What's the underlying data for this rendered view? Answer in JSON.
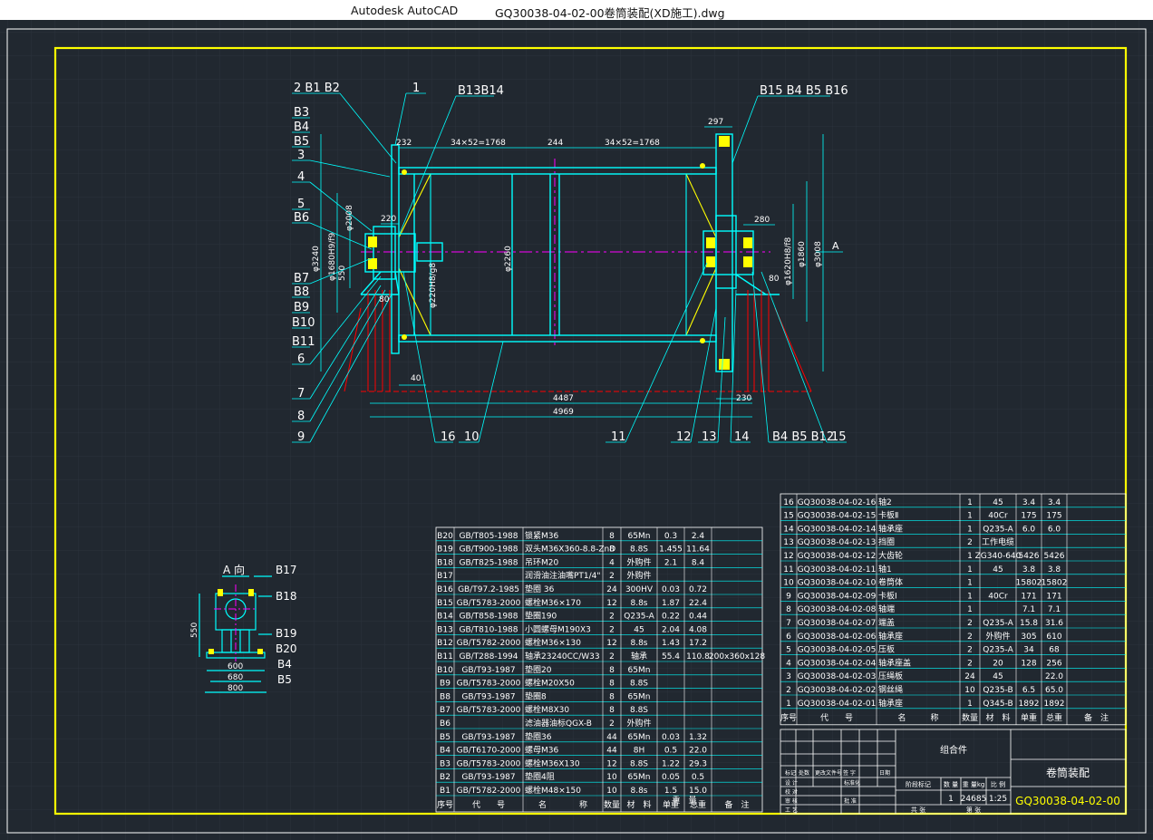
{
  "titlebar": {
    "app": "Autodesk AutoCAD",
    "file": "GQ30038-04-02-00卷筒装配(XD施工).dwg"
  },
  "colors": {
    "canvas": "#212830",
    "frame": "#ffff00",
    "outline": "#00ffff",
    "grid": "#2c3540",
    "centerline": "#ff00ff",
    "hidden": "#ff0000",
    "text": "#ffffff"
  },
  "drawing": {
    "balloons": {
      "b2b1b2": "2 B1 B2",
      "b1": "1",
      "b13b14": "B13B14",
      "b15b16": "B15 B4 B5 B16",
      "b3": "B3",
      "b4": "B4",
      "b5": "B5",
      "b3n": "3",
      "b4n": "4",
      "b5n": "5",
      "b6": "B6",
      "b7": "B7",
      "b8": "B8",
      "b9": "B9",
      "b10": "B10",
      "b11": "B11",
      "b6n": "6",
      "b7n": "7",
      "b8n": "8",
      "b9n": "9",
      "b16n": "16",
      "b10n": "10",
      "b11n": "11",
      "b12n": "12",
      "b13n": "13",
      "b14n": "14",
      "b4b5b12": "B4 B5 B12",
      "b15n": "15"
    },
    "dims": {
      "d297": "297",
      "d232": "232",
      "pitch_left": "34×52=1768",
      "d244": "244",
      "pitch_right": "34×52=1768",
      "d220": "220",
      "d280": "280",
      "d80": "80",
      "d40": "40",
      "d4487": "4487",
      "d4969": "4969",
      "d230": "230",
      "phi3240": "φ3240",
      "phi1680": "φ1680H9/f9",
      "phi2008": "φ2008",
      "d550": "550",
      "phi2260": "φ2260",
      "phi220": "φ220H8/g8",
      "phi1620": "φ1620H8/f8",
      "phi1860": "φ1860",
      "phi3008": "φ3008",
      "d80b": "80",
      "view_a": "A"
    },
    "side_view": {
      "title": "A 向",
      "b17": "B17",
      "b18": "B18",
      "b19": "B19",
      "b20": "B20",
      "b4": "B4",
      "b5": "B5",
      "d550": "550",
      "d600": "600",
      "d680": "680",
      "d800": "800"
    }
  },
  "bom_left": {
    "rows": [
      [
        "B20",
        "GB/T805-1988",
        "锁紧M36",
        "8",
        "65Mn",
        "0.3",
        "2.4",
        ""
      ],
      [
        "B19",
        "GB/T900-1988",
        "双头M36X360-8.8-ZnD",
        "8",
        "8.8S",
        "1.455",
        "11.64",
        ""
      ],
      [
        "B18",
        "GB/T825-1988",
        "吊环M20",
        "4",
        "外购件",
        "2.1",
        "8.4",
        ""
      ],
      [
        "B17",
        "",
        "润滑油注油嘴PT1/4\"",
        "2",
        "外购件",
        "",
        "",
        ""
      ],
      [
        "B16",
        "GB/T97.2-1985",
        "垫圈 36",
        "24",
        "300HV",
        "0.03",
        "0.72",
        ""
      ],
      [
        "B15",
        "GB/T5783-2000",
        "螺栓M36×170",
        "12",
        "8.8s",
        "1.87",
        "22.4",
        ""
      ],
      [
        "B14",
        "GB/T858-1988",
        "垫圈190",
        "2",
        "Q235-A",
        "0.22",
        "0.44",
        ""
      ],
      [
        "B13",
        "GB/T810-1988",
        "小圆螺母M190X3",
        "2",
        "45",
        "2.04",
        "4.08",
        ""
      ],
      [
        "B12",
        "GB/T5782-2000",
        "螺栓M36×130",
        "12",
        "8.8s",
        "1.43",
        "17.2",
        ""
      ],
      [
        "B11",
        "GB/T288-1994",
        "轴承23240CC/W33",
        "2",
        "轴承",
        "55.4",
        "110.8",
        "200x360x128"
      ],
      [
        "B10",
        "GB/T93-1987",
        "垫圈20",
        "8",
        "65Mn",
        "",
        "",
        ""
      ],
      [
        "B9",
        "GB/T5783-2000",
        "螺栓M20X50",
        "8",
        "8.8S",
        "",
        "",
        ""
      ],
      [
        "B8",
        "GB/T93-1987",
        "垫圈8",
        "8",
        "65Mn",
        "",
        "",
        ""
      ],
      [
        "B7",
        "GB/T5783-2000",
        "螺栓M8X30",
        "8",
        "8.8S",
        "",
        "",
        ""
      ],
      [
        "B6",
        "",
        "滤油器油标QGX-B",
        "2",
        "外购件",
        "",
        "",
        ""
      ],
      [
        "B5",
        "GB/T93-1987",
        "垫圈36",
        "44",
        "65Mn",
        "0.03",
        "1.32",
        ""
      ],
      [
        "B4",
        "GB/T6170-2000",
        "螺母M36",
        "44",
        "8H",
        "0.5",
        "22.0",
        ""
      ],
      [
        "B3",
        "GB/T5783-2000",
        "螺栓M36X130",
        "12",
        "8.8S",
        "1.22",
        "29.3",
        ""
      ],
      [
        "B2",
        "GB/T93-1987",
        "垫圈4阻",
        "10",
        "65Mn",
        "0.05",
        "0.5",
        ""
      ],
      [
        "B1",
        "GB/T5782-2000",
        "螺栓M48×150",
        "10",
        "8.8s",
        "1.5",
        "15.0",
        ""
      ]
    ],
    "header": [
      "序号",
      "代　　号",
      "名　　　　称",
      "数量",
      "材　料",
      "单重",
      "总重",
      "备　注"
    ],
    "weight_sub": "重　量"
  },
  "bom_right": {
    "rows": [
      [
        "16",
        "GQ30038-04-02-16",
        "轴2",
        "1",
        "45",
        "3.4",
        "3.4",
        ""
      ],
      [
        "15",
        "GQ30038-04-02-15",
        "卡板Ⅱ",
        "1",
        "40Cr",
        "175",
        "175",
        ""
      ],
      [
        "14",
        "GQ30038-04-02-14",
        "轴承座",
        "1",
        "Q235-A",
        "6.0",
        "6.0",
        ""
      ],
      [
        "13",
        "GQ30038-04-02-13",
        "挡圈",
        "2",
        "工作电缆",
        "",
        "",
        ""
      ],
      [
        "12",
        "GQ30038-04-02-12",
        "大齿轮",
        "1",
        "ZG340-640",
        "5426",
        "5426",
        ""
      ],
      [
        "11",
        "GQ30038-04-02-11",
        "轴1",
        "1",
        "45",
        "3.8",
        "3.8",
        ""
      ],
      [
        "10",
        "GQ30038-04-02-10",
        "卷筒体",
        "1",
        "",
        "15802",
        "15802",
        ""
      ],
      [
        "9",
        "GQ30038-04-02-09",
        "卡板Ⅰ",
        "1",
        "40Cr",
        "171",
        "171",
        ""
      ],
      [
        "8",
        "GQ30038-04-02-08",
        "轴端",
        "1",
        "",
        "7.1",
        "7.1",
        ""
      ],
      [
        "7",
        "GQ30038-04-02-07",
        "端盖",
        "2",
        "Q235-A",
        "15.8",
        "31.6",
        ""
      ],
      [
        "6",
        "GQ30038-04-02-06",
        "轴承座",
        "2",
        "外购件",
        "305",
        "610",
        ""
      ],
      [
        "5",
        "GQ30038-04-02-05",
        "压板",
        "2",
        "Q235-A",
        "34",
        "68",
        ""
      ],
      [
        "4",
        "GQ30038-04-02-04",
        "轴承座盖",
        "2",
        "20",
        "128",
        "256",
        ""
      ],
      [
        "3",
        "GQ30038-04-02-03",
        "压绳板",
        "24",
        "45",
        "",
        "22.0",
        ""
      ],
      [
        "2",
        "GQ30038-04-02-02",
        "钢丝绳",
        "10",
        "Q235-B",
        "6.5",
        "65.0",
        ""
      ],
      [
        "1",
        "GQ30038-04-02-01",
        "轴承座",
        "1",
        "Q345-B",
        "1892",
        "1892",
        ""
      ]
    ],
    "header": [
      "序号",
      "代　　号",
      "名　　　称",
      "数量",
      "材　料",
      "单重",
      "总重",
      "备　注"
    ]
  },
  "title_block": {
    "assembly": "组合件",
    "name": "卷筒装配",
    "drawing_no": "GQ30038-04-02-00",
    "scale_label": "比 例",
    "scale": "1:25",
    "weight_label": "重 量kg",
    "weight": "24685",
    "qty_label": "数 量",
    "qty": "1",
    "stage_label": "阶段标记",
    "rows_left": [
      "标记",
      "处数",
      "更改文件号",
      "签 字",
      "日期"
    ],
    "designer": "设 计",
    "checker": "校 对",
    "reviewer": "审 核",
    "process": "工 艺",
    "standard": "标准化",
    "approve": "批 准",
    "sheet": "共 张",
    "page": "第 张"
  }
}
